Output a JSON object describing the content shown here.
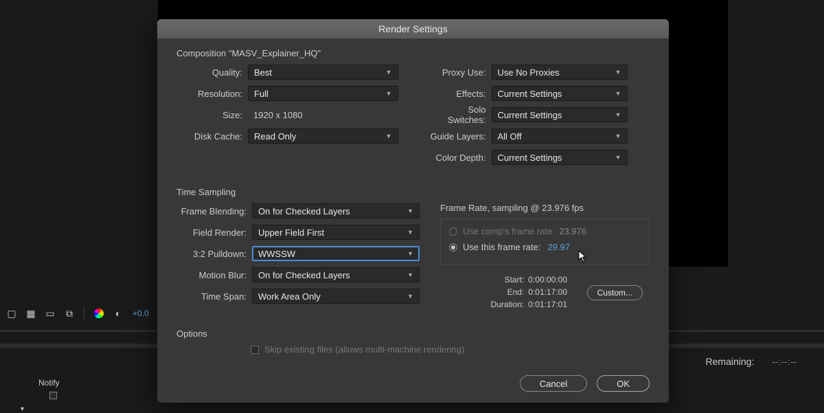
{
  "dialog": {
    "title": "Render Settings",
    "composition_label": "Composition \"MASV_Explainer_HQ\"",
    "left": {
      "quality": {
        "label": "Quality:",
        "value": "Best"
      },
      "resolution": {
        "label": "Resolution:",
        "value": "Full"
      },
      "size": {
        "label": "Size:",
        "value": "1920 x 1080"
      },
      "disk_cache": {
        "label": "Disk Cache:",
        "value": "Read Only"
      }
    },
    "right": {
      "proxy_use": {
        "label": "Proxy Use:",
        "value": "Use No Proxies"
      },
      "effects": {
        "label": "Effects:",
        "value": "Current Settings"
      },
      "solo_switches": {
        "label": "Solo Switches:",
        "value": "Current Settings"
      },
      "guide_layers": {
        "label": "Guide Layers:",
        "value": "All Off"
      },
      "color_depth": {
        "label": "Color Depth:",
        "value": "Current Settings"
      }
    },
    "time_sampling": {
      "section_label": "Time Sampling",
      "frame_blending": {
        "label": "Frame Blending:",
        "value": "On for Checked Layers"
      },
      "field_render": {
        "label": "Field Render:",
        "value": "Upper Field First"
      },
      "pulldown": {
        "label": "3:2 Pulldown:",
        "value": "WWSSW"
      },
      "motion_blur": {
        "label": "Motion Blur:",
        "value": "On for Checked Layers"
      },
      "time_span": {
        "label": "Time Span:",
        "value": "Work Area Only"
      }
    },
    "frame_rate": {
      "header": "Frame Rate, sampling @ 23.976 fps",
      "use_comp_label": "Use comp's frame rate",
      "use_comp_value": "23.976",
      "use_this_label": "Use this frame rate:",
      "use_this_value": "29.97"
    },
    "timing": {
      "start_label": "Start:",
      "start": "0:00:00:00",
      "end_label": "End:",
      "end": "0:01:17:00",
      "duration_label": "Duration:",
      "duration": "0:01:17:01",
      "custom_label": "Custom..."
    },
    "options": {
      "section_label": "Options",
      "skip_label": "Skip existing files (allows multi-machine rendering)"
    },
    "buttons": {
      "cancel": "Cancel",
      "ok": "OK"
    }
  },
  "toolbar": {
    "shutter_value": "+0.0"
  },
  "status": {
    "remaining_label": "Remaining:",
    "remaining_value": "--:--:--"
  },
  "notify": {
    "label": "Notify"
  }
}
